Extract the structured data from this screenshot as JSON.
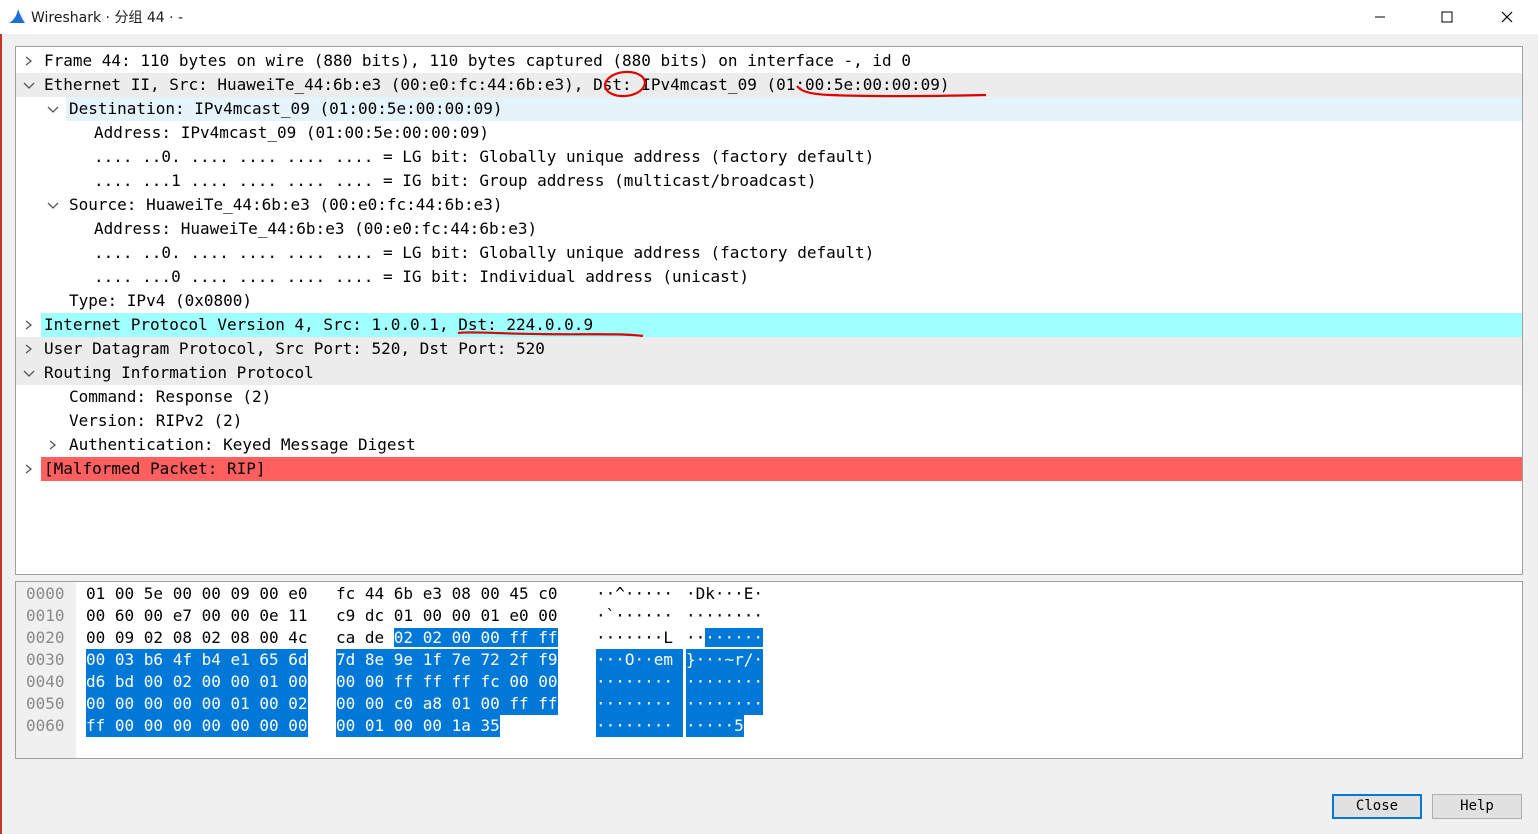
{
  "window": {
    "title": "Wireshark · 分组 44 · -",
    "controls": {
      "minimize": "—",
      "maximize": "☐",
      "close": "✕"
    }
  },
  "tree": [
    {
      "text": "Frame 44: 110 bytes on wire (880 bits), 110 bytes captured (880 bits) on interface -, id 0",
      "arrow": "collapsed",
      "bg": "none"
    },
    {
      "text": "Ethernet II, Src: HuaweiTe_44:6b:e3 (00:e0:fc:44:6b:e3), Dst: IPv4mcast_09 (01:00:5e:00:00:09)",
      "arrow": "expanded",
      "bg": "#ececec"
    },
    {
      "text": "Destination: IPv4mcast_09 (01:00:5e:00:00:09)",
      "arrow": "expanded",
      "bg": "#e5f3fb"
    },
    {
      "text": "Address: IPv4mcast_09 (01:00:5e:00:00:09)",
      "arrow": "none",
      "bg": "none"
    },
    {
      "text": ".... ..0. .... .... .... .... = LG bit: Globally unique address (factory default)",
      "arrow": "none",
      "bg": "none"
    },
    {
      "text": ".... ...1 .... .... .... .... = IG bit: Group address (multicast/broadcast)",
      "arrow": "none",
      "bg": "none"
    },
    {
      "text": "Source: HuaweiTe_44:6b:e3 (00:e0:fc:44:6b:e3)",
      "arrow": "expanded",
      "bg": "none"
    },
    {
      "text": "Address: HuaweiTe_44:6b:e3 (00:e0:fc:44:6b:e3)",
      "arrow": "none",
      "bg": "none"
    },
    {
      "text": ".... ..0. .... .... .... .... = LG bit: Globally unique address (factory default)",
      "arrow": "none",
      "bg": "none"
    },
    {
      "text": ".... ...0 .... .... .... .... = IG bit: Individual address (unicast)",
      "arrow": "none",
      "bg": "none"
    },
    {
      "text": "Type: IPv4 (0x0800)",
      "arrow": "none",
      "bg": "none"
    },
    {
      "text": "Internet Protocol Version 4, Src: 1.0.0.1, Dst: 224.0.0.9",
      "arrow": "collapsed",
      "bg": "#a0ffff"
    },
    {
      "text": "User Datagram Protocol, Src Port: 520, Dst Port: 520",
      "arrow": "collapsed",
      "bg": "#ececec"
    },
    {
      "text": "Routing Information Protocol",
      "arrow": "expanded",
      "bg": "#ececec"
    },
    {
      "text": "Command: Response (2)",
      "arrow": "none",
      "bg": "none"
    },
    {
      "text": "Version: RIPv2 (2)",
      "arrow": "none",
      "bg": "none"
    },
    {
      "text": "Authentication: Keyed Message Digest",
      "arrow": "collapsed",
      "bg": "none"
    },
    {
      "text": "[Malformed Packet: RIP]",
      "arrow": "collapsed",
      "bg": "#ff5f5f"
    }
  ],
  "hex": [
    {
      "offset": "0000",
      "b1": "01 00 5e 00 00 09 00 e0",
      "b2": "fc 44 6b e3 08 00 45 c0",
      "a1": "··^····· ",
      "a2": "·Dk···E·"
    },
    {
      "offset": "0010",
      "b1": "00 60 00 e7 00 00 0e 11",
      "b2": "c9 dc 01 00 00 01 e0 00",
      "a1": "·`······ ",
      "a2": "········"
    },
    {
      "offset": "0020",
      "b1": "00 09 02 08 02 08 00 4c",
      "b2": "ca de 02 02 00 00 ff ff",
      "a1": "·······L ",
      "a2": "········"
    },
    {
      "offset": "0030",
      "b1": "00 03 b6 4f b4 e1 65 6d",
      "b2": "7d 8e 9e 1f 7e 72 2f f9",
      "a1": "···O··em ",
      "a2": "}···~r/·"
    },
    {
      "offset": "0040",
      "b1": "d6 bd 00 02 00 00 01 00",
      "b2": "00 00 ff ff ff fc 00 00",
      "a1": "········ ",
      "a2": "········"
    },
    {
      "offset": "0050",
      "b1": "00 00 00 00 00 01 00 02",
      "b2": "00 00 c0 a8 01 00 ff ff",
      "a1": "········ ",
      "a2": "········"
    },
    {
      "offset": "0060",
      "b1": "ff 00 00 00 00 00 00 00",
      "b2": "00 01 00 00 1a 35",
      "a1": "········ ",
      "a2": "·····5"
    }
  ],
  "buttons": {
    "close": "Close",
    "help": "Help"
  },
  "colors": {
    "selection": "#0078d7",
    "annotation": "#e00000"
  }
}
